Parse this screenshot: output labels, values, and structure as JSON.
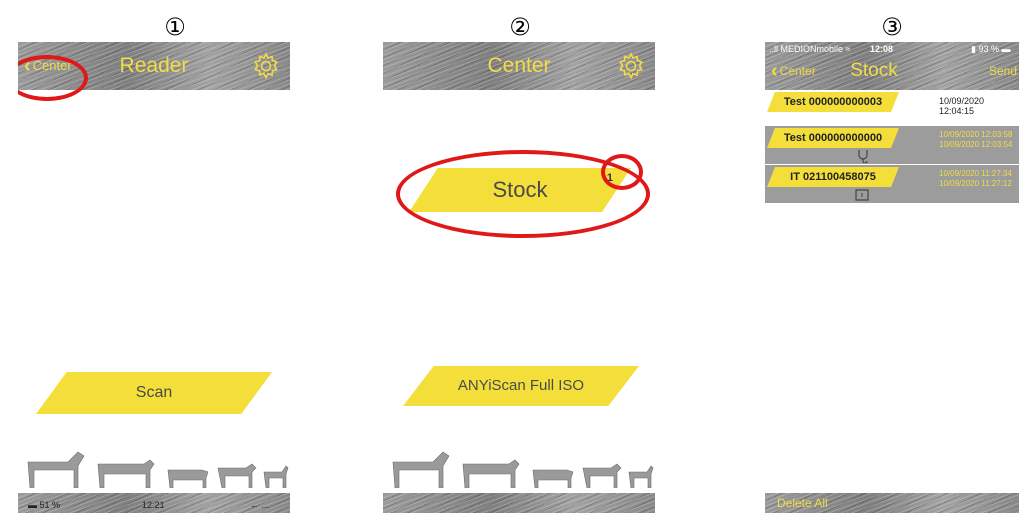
{
  "steps": [
    "①",
    "②",
    "③"
  ],
  "screen1": {
    "back_label": "Center",
    "title": "Reader",
    "scan_button": "Scan",
    "footer_status": [
      "▬ 51 %",
      "12:21",
      "← ..."
    ]
  },
  "screen2": {
    "title": "Center",
    "stock_button": "Stock",
    "stock_badge": "1",
    "scan_full_button": "ANYiScan Full ISO"
  },
  "screen3": {
    "status": {
      "carrier": "..ll MEDIONmobile ≈",
      "time": "12:08",
      "battery": "▮ 93 % ▬"
    },
    "back_label": "Center",
    "title": "Stock",
    "send_label": "Send",
    "items": [
      {
        "id": "Test 000000000003",
        "dates": [
          "10/09/2020 12:04:15"
        ],
        "icon": ""
      },
      {
        "id": "Test 000000000000",
        "dates": [
          "10/09/2020 12:03:58",
          "10/09/2020 12:03:54"
        ],
        "icon": "stethoscope-icon"
      },
      {
        "id": "IT 021100458075",
        "dates": [
          "10/09/2020 11:27:34",
          "10/09/2020 11:27:12"
        ],
        "icon": "tablet-icon"
      }
    ],
    "delete_all": "Delete All"
  },
  "colors": {
    "accent": "#f2dc45",
    "button": "#f4df3a",
    "highlight_ring": "#e01818",
    "header": "#8c8c8c"
  }
}
